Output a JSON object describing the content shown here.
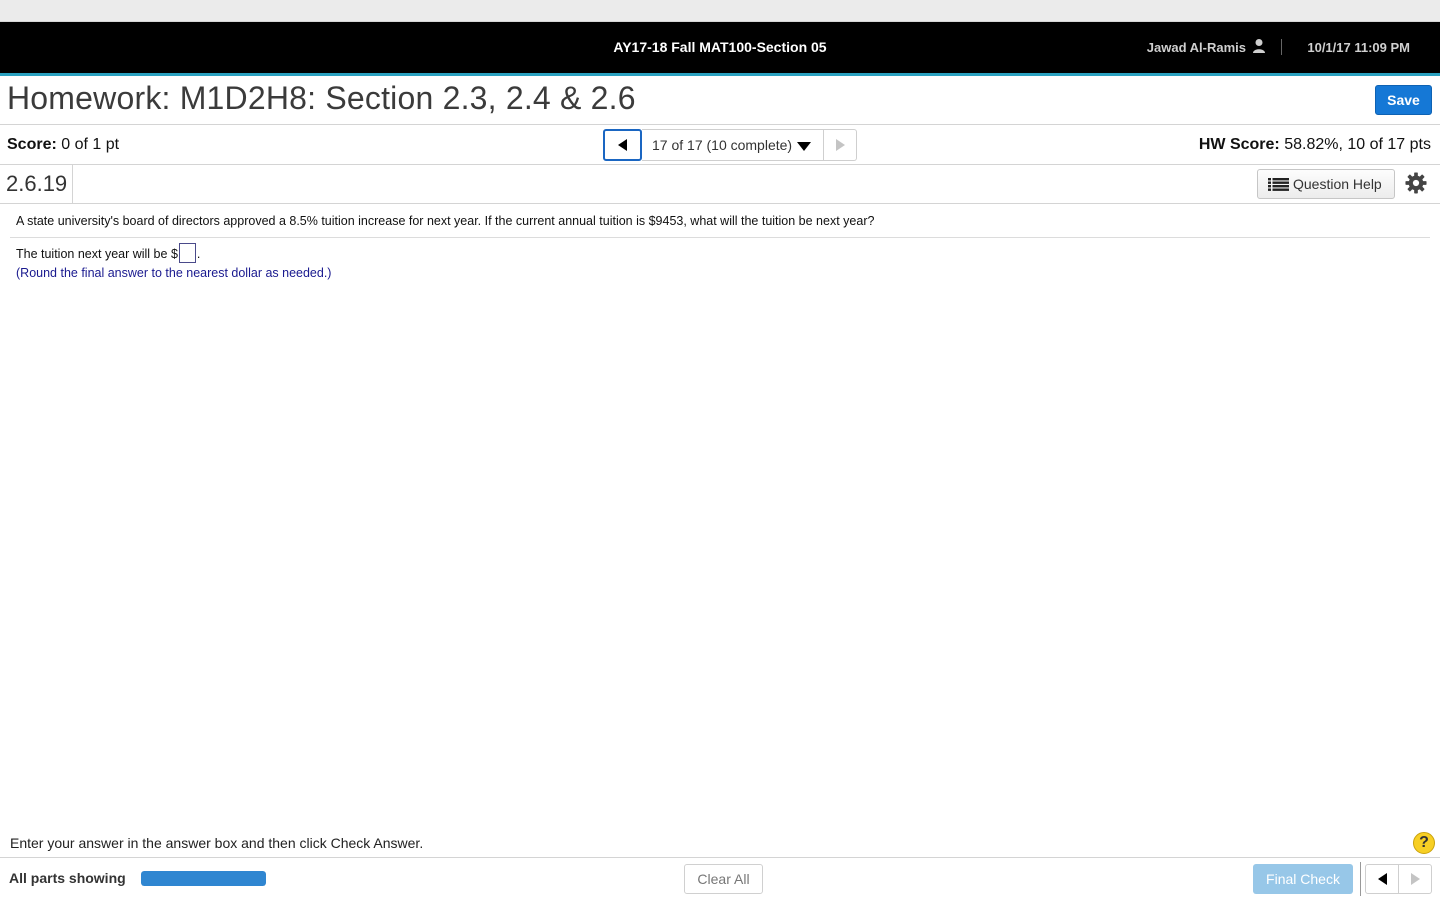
{
  "header": {
    "course_title": "AY17-18 Fall MAT100-Section 05",
    "user_name": "Jawad Al-Ramis",
    "user_icon": "user-icon",
    "date_time": "10/1/17 11:09 PM",
    "accent_color": "#2aa1c0"
  },
  "homework": {
    "title": "Homework: M1D2H8: Section 2.3, 2.4 & 2.6",
    "save_label": "Save"
  },
  "score_bar": {
    "score_label": "Score:",
    "score_value": "0 of 1 pt",
    "question_selector": "17 of 17 (10 complete)",
    "hw_score_label": "HW Score:",
    "hw_score_value": "58.82%, 10 of 17 pts"
  },
  "question": {
    "id": "2.6.19",
    "help_label": "Question Help",
    "help_icon": "list-icon",
    "settings_icon": "gear-icon",
    "text": "A state university's board of directors approved a 8.5% tuition increase for next year. If the current annual tuition is $9453, what will the tuition be next year?",
    "answer_prefix": "The tuition next year will be $",
    "answer_value": "",
    "answer_suffix": ".",
    "round_note": "(Round the final answer to the nearest dollar as needed.)"
  },
  "footer": {
    "instruction": "Enter your answer in the answer box and then click Check Answer.",
    "help_glyph": "?",
    "parts_label": "All parts showing",
    "parts_progress": 1.0,
    "clear_label": "Clear All",
    "final_label": "Final Check",
    "brand_blue": "#1578d6"
  }
}
